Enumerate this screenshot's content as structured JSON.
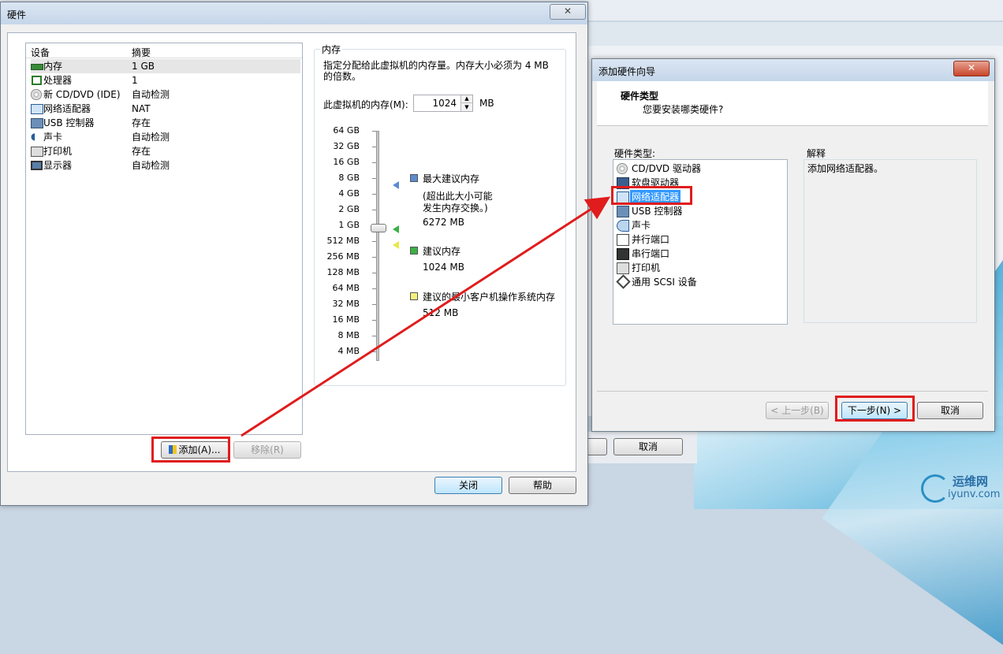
{
  "hardware_dialog": {
    "title": "硬件",
    "close_glyph": "✕",
    "columns": [
      "设备",
      "摘要"
    ],
    "devices": [
      {
        "name": "内存",
        "summary": "1 GB",
        "icon": "memory-icon"
      },
      {
        "name": "处理器",
        "summary": "1",
        "icon": "cpu-icon"
      },
      {
        "name": "新 CD/DVD (IDE)",
        "summary": "自动检测",
        "icon": "cd-icon"
      },
      {
        "name": "网络适配器",
        "summary": "NAT",
        "icon": "network-icon"
      },
      {
        "name": "USB 控制器",
        "summary": "存在",
        "icon": "usb-icon"
      },
      {
        "name": "声卡",
        "summary": "自动检测",
        "icon": "sound-icon"
      },
      {
        "name": "打印机",
        "summary": "存在",
        "icon": "printer-icon"
      },
      {
        "name": "显示器",
        "summary": "自动检测",
        "icon": "display-icon"
      }
    ],
    "add_button": "添加(A)...",
    "remove_button": "移除(R)",
    "close_button": "关闭",
    "help_button": "帮助",
    "memory": {
      "group_title": "内存",
      "description_line1": "指定分配给此虚拟机的内存量。内存大小必须为 4 MB",
      "description_line2": "的倍数。",
      "field_label": "此虚拟机的内存(M):",
      "value": "1024",
      "unit": "MB",
      "scale": [
        "64 GB",
        "32 GB",
        "16 GB",
        "8 GB",
        "4 GB",
        "2 GB",
        "1 GB",
        "512 MB",
        "256 MB",
        "128 MB",
        "64 MB",
        "32 MB",
        "16 MB",
        "8 MB",
        "4 MB"
      ],
      "max_title": "最大建议内存",
      "max_note_line1": "(超出此大小可能",
      "max_note_line2": "发生内存交换。)",
      "max_value": "6272 MB",
      "rec_title": "建议内存",
      "rec_value": "1024 MB",
      "min_title": "建议的最小客户机操作系统内存",
      "min_value": "512 MB",
      "colors": {
        "max": "#5b8bd0",
        "rec": "#3cb043",
        "min": "#f2f27a"
      }
    }
  },
  "wizard": {
    "title": "添加硬件向导",
    "close_glyph": "✕",
    "header_title": "硬件类型",
    "header_subtitle": "您要安装哪类硬件?",
    "list_label": "硬件类型:",
    "items": [
      {
        "name": "CD/DVD 驱动器",
        "icon": "cd-icon"
      },
      {
        "name": "软盘驱动器",
        "icon": "floppy-icon"
      },
      {
        "name": "网络适配器",
        "icon": "network-icon",
        "selected": true
      },
      {
        "name": "USB 控制器",
        "icon": "usb-icon"
      },
      {
        "name": "声卡",
        "icon": "sound-icon"
      },
      {
        "name": "并行端口",
        "icon": "parallel-port-icon"
      },
      {
        "name": "串行端口",
        "icon": "serial-port-icon"
      },
      {
        "name": "打印机",
        "icon": "printer-icon"
      },
      {
        "name": "通用 SCSI 设备",
        "icon": "scsi-icon"
      }
    ],
    "explain_label": "解释",
    "explain_text": "添加网络适配器。",
    "back_button": "< 上一步(B)",
    "next_button": "下一步(N) >",
    "cancel_button": "取消"
  },
  "background": {
    "cancel_button": "取消"
  },
  "watermark": {
    "text_top": "运维网",
    "text_bottom": "iyunv.com"
  }
}
